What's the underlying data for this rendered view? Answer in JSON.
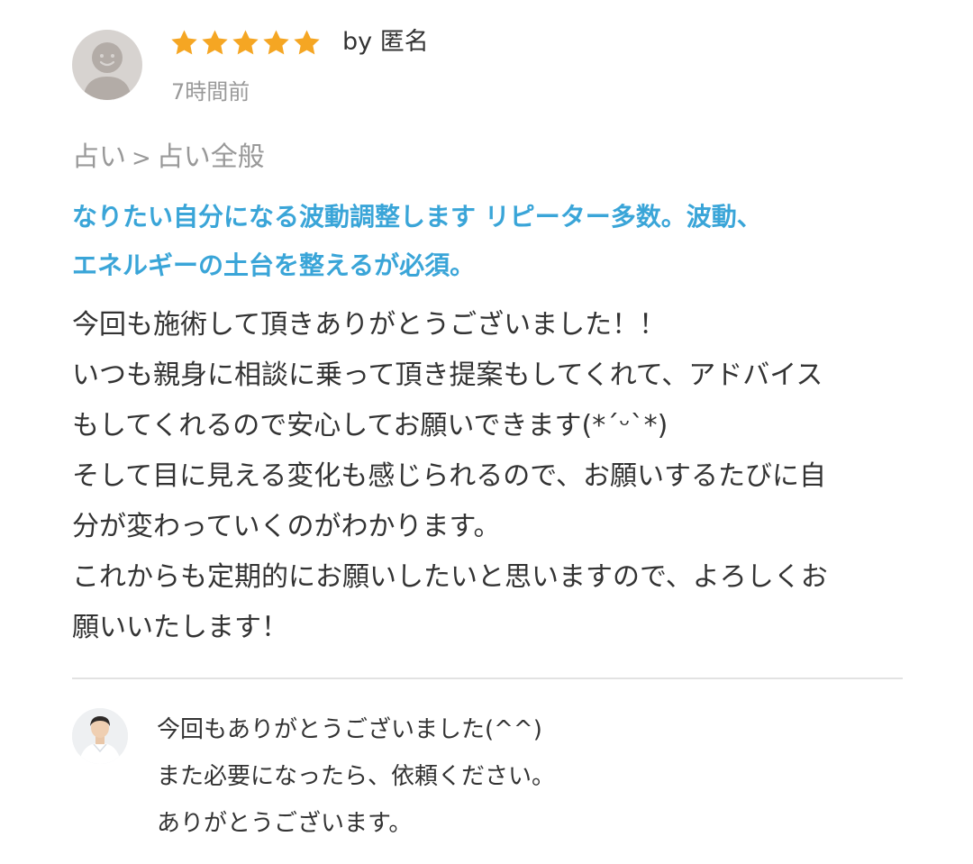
{
  "review": {
    "rating": 5,
    "star_color": "#f5a623",
    "by_name": "by 匿名",
    "posted": "7時間前",
    "avatar_icon": "default-user-icon",
    "category": {
      "parent": "占い",
      "separator": ">",
      "child": "占い全般"
    },
    "service_title_lines": [
      "なりたい自分になる波動調整します リピーター多数。波動、",
      "エネルギーの土台を整えるが必須。"
    ],
    "title_color": "#3aa5d8",
    "body_lines": [
      "今回も施術して頂きありがとうございました！！",
      "いつも親身に相談に乗って頂き提案もしてくれて、アドバイス",
      "もしてくれるので安心してお願いできます(*´ᵕ`*)",
      "そして目に見える変化も感じられるので、お願いするたびに自",
      "分が変わっていくのがわかります。",
      "これからも定期的にお願いしたいと思いますので、よろしくお",
      "願いいたします！"
    ]
  },
  "reply": {
    "avatar_icon": "seller-photo-icon",
    "lines": [
      "今回もありがとうございました(^^)",
      "また必要になったら、依頼ください。",
      "ありがとうございます。"
    ]
  }
}
